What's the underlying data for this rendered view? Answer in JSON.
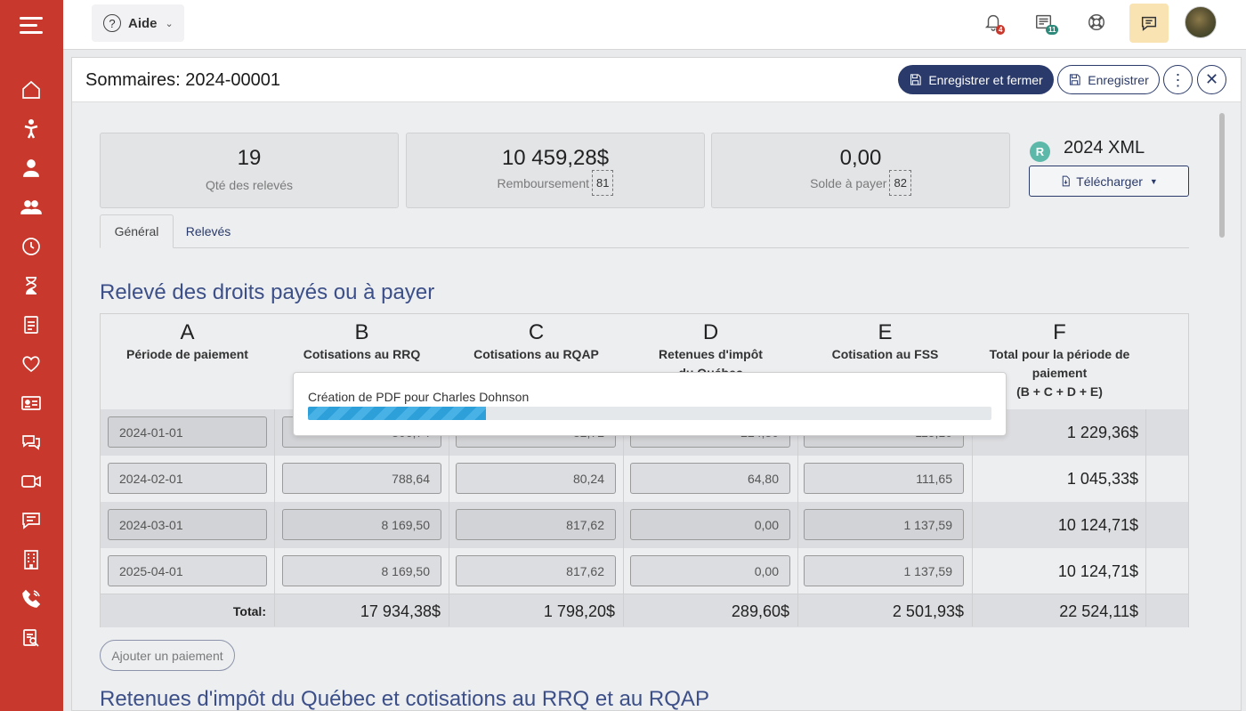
{
  "topbar": {
    "help_label": "Aide",
    "notifications_badge": "4",
    "news_badge": "11"
  },
  "panel": {
    "title": "Sommaires: 2024-00001",
    "save_close_label": "Enregistrer et fermer",
    "save_label": "Enregistrer"
  },
  "summary": {
    "qty_value": "19",
    "qty_label": "Qté des relevés",
    "refund_value": "10 459,28$",
    "refund_label": "Remboursement",
    "refund_code": "81",
    "balance_value": "0,00",
    "balance_label": "Solde à payer",
    "balance_code": "82"
  },
  "xml": {
    "badge": "R",
    "title": "2024 XML",
    "download_label": "Télécharger"
  },
  "tabs": [
    {
      "label": "Général",
      "active": true
    },
    {
      "label": "Relevés",
      "active": false
    }
  ],
  "section": {
    "title": "Relevé des droits payés ou à payer",
    "next_title": "Retenues d'impôt du Québec et cotisations au RRQ et au RQAP"
  },
  "table": {
    "columns": [
      {
        "letter": "A",
        "name": "Période de paiement"
      },
      {
        "letter": "B",
        "name": "Cotisations au RRQ"
      },
      {
        "letter": "C",
        "name": "Cotisations au RQAP"
      },
      {
        "letter": "D",
        "name": "Retenues d'impôt du Québec"
      },
      {
        "letter": "E",
        "name": "Cotisation au FSS"
      },
      {
        "letter": "F",
        "name": "Total pour la période de paiement",
        "formula": "(B + C + D + E)"
      }
    ],
    "rows": [
      {
        "period": "2024-01-01",
        "b": "806,74",
        "c": "82,72",
        "d": "224,80",
        "e": "115,10",
        "total": "1 229,36$"
      },
      {
        "period": "2024-02-01",
        "b": "788,64",
        "c": "80,24",
        "d": "64,80",
        "e": "111,65",
        "total": "1 045,33$"
      },
      {
        "period": "2024-03-01",
        "b": "8 169,50",
        "c": "817,62",
        "d": "0,00",
        "e": "1 137,59",
        "total": "10 124,71$"
      },
      {
        "period": "2025-04-01",
        "b": "8 169,50",
        "c": "817,62",
        "d": "0,00",
        "e": "1 137,59",
        "total": "10 124,71$"
      }
    ],
    "total_label": "Total:",
    "totals": {
      "b": "17 934,38$",
      "c": "1 798,20$",
      "d": "289,60$",
      "e": "2 501,93$",
      "f": "22 524,11$"
    }
  },
  "add_payment_label": "Ajouter un paiement",
  "progress": {
    "text": "Création de PDF pour Charles Dohnson",
    "percent": 26
  },
  "colors": {
    "sidebar": "#c8382c",
    "primary": "#2a3a6a",
    "heading": "#3c4f88",
    "progress": "#2d9fd9"
  }
}
